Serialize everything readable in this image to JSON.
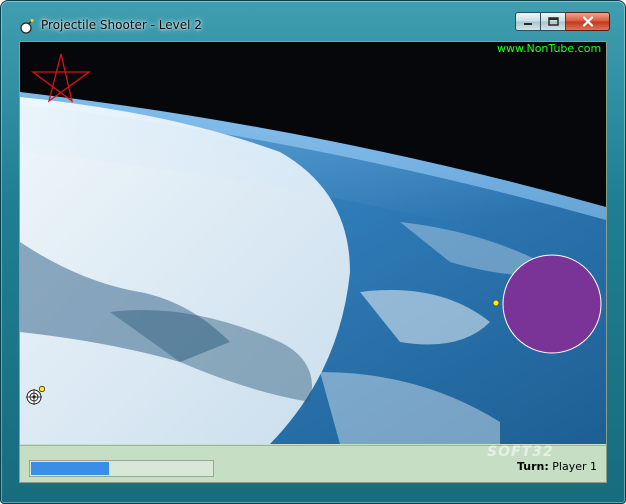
{
  "window": {
    "title": "Projectile Shooter - Level 2",
    "icon": "bomb-icon"
  },
  "caption_buttons": {
    "minimize": "minimize-icon",
    "maximize": "maximize-icon",
    "close": "close-icon"
  },
  "game": {
    "site_url": "www.NonTube.com",
    "background": "earth-from-orbit",
    "star_color": "#e01010",
    "planet_color": "#7a3497",
    "projectile_color": "#ffee00",
    "player_icon": "crosshair-icon"
  },
  "hud": {
    "power_level": 0.43,
    "turn_label": "Turn:",
    "turn_value": "Player 1"
  },
  "watermark": "SOFT32"
}
